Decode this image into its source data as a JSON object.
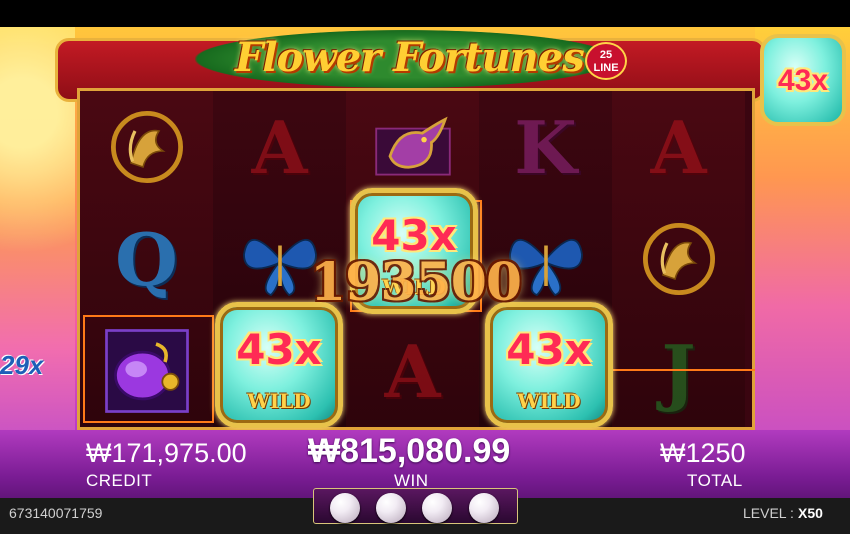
{
  "game": {
    "title": "Flower Fortunes",
    "line_badge": "25 LINE"
  },
  "reels": {
    "symbols": [
      [
        "phoenix",
        "Q",
        "bug"
      ],
      [
        "A",
        "butterfly",
        "wild"
      ],
      [
        "bird",
        "wild",
        "A"
      ],
      [
        "K",
        "butterfly",
        "wild"
      ],
      [
        "A",
        "phoenix",
        "J"
      ]
    ]
  },
  "wild": {
    "multiplier": "43x",
    "label": "WILD"
  },
  "corner_multiplier": "43x",
  "payline_left_label": "29x",
  "win_amount_overlay": "193500",
  "footer": {
    "credit_value": "₩171,975.00",
    "credit_label": "CREDIT",
    "win_value": "₩815,080.99",
    "win_label": "WIN",
    "total_value": "₩1250",
    "total_label": "TOTAL",
    "session_id": "673140071759",
    "level_label": "LEVEL :",
    "level_value": "X50",
    "pearls_count": 4
  },
  "colors": {
    "accent_gold": "#e8c24a",
    "wild_teal": "#2cc0b0",
    "multiplier_red": "#ff2a55",
    "payline_orange": "#ff7a18"
  }
}
